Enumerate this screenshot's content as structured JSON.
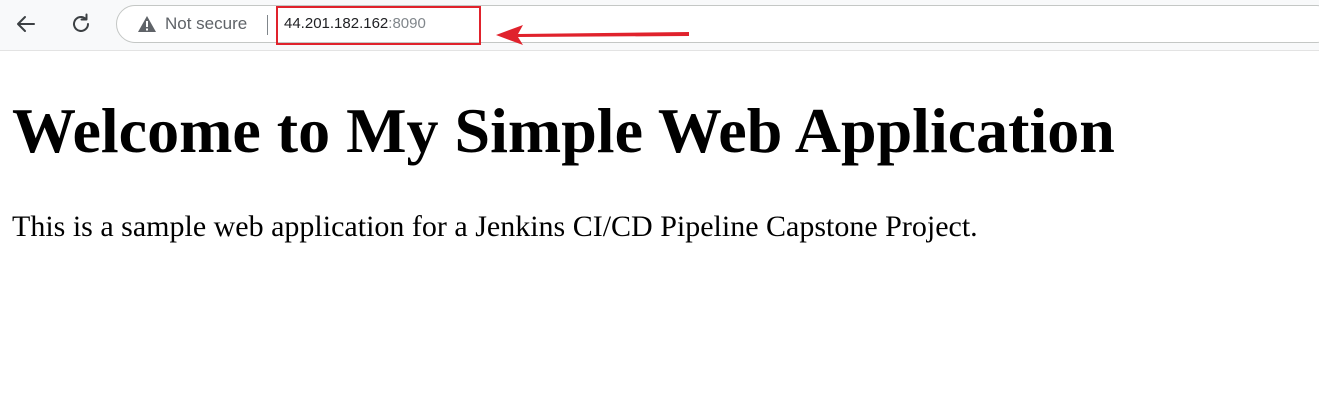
{
  "browser": {
    "security_label": "Not secure",
    "address": {
      "host": "44.201.182.162",
      "port": ":8090"
    },
    "icons": {
      "back": "back-arrow-icon",
      "reload": "reload-icon",
      "security": "warning-triangle-icon"
    }
  },
  "annotation": {
    "color": "#e0222c"
  },
  "page": {
    "heading": "Welcome to My Simple Web Application",
    "paragraph": "This is a sample web application for a Jenkins CI/CD Pipeline Capstone Project."
  }
}
